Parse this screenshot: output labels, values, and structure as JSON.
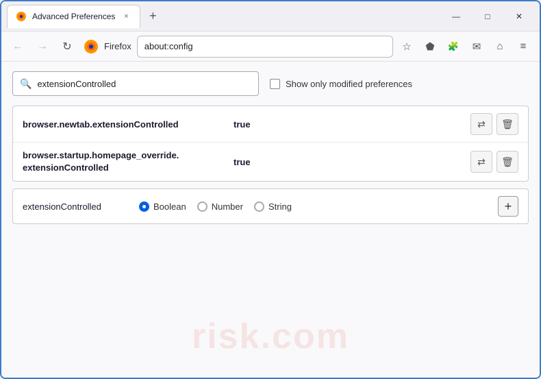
{
  "window": {
    "title": "Advanced Preferences",
    "tab_close": "×",
    "new_tab": "+",
    "win_minimize": "—",
    "win_maximize": "□",
    "win_close": "✕"
  },
  "nav": {
    "back": "←",
    "forward": "→",
    "reload": "↻",
    "browser_name": "Firefox",
    "address": "about:config",
    "bookmark_icon": "☆",
    "pocket_icon": "⬡",
    "extension_icon": "⬛",
    "mail_icon": "✉",
    "account_icon": "⌂",
    "menu_icon": "≡"
  },
  "search": {
    "placeholder": "extensionControlled",
    "value": "extensionControlled",
    "show_modified_label": "Show only modified preferences",
    "search_icon": "🔍"
  },
  "results": [
    {
      "name": "browser.newtab.extensionControlled",
      "value": "true"
    },
    {
      "name1": "browser.startup.homepage_override.",
      "name2": "extensionControlled",
      "value": "true"
    }
  ],
  "add_preference": {
    "name": "extensionControlled",
    "radio_options": [
      {
        "label": "Boolean",
        "selected": true
      },
      {
        "label": "Number",
        "selected": false
      },
      {
        "label": "String",
        "selected": false
      }
    ],
    "add_icon": "+"
  },
  "watermark": "risk.com",
  "icons": {
    "swap": "⇄",
    "delete": "🗑",
    "search": "⌕"
  }
}
